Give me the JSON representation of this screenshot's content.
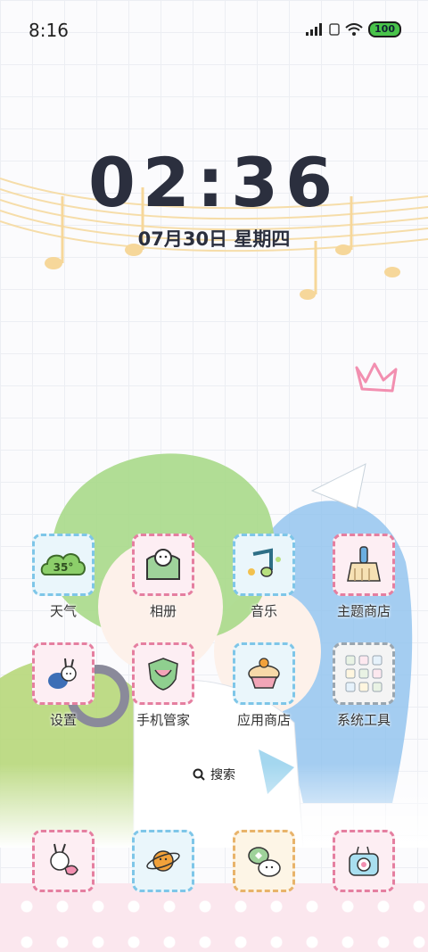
{
  "status": {
    "time": "8:16",
    "battery": "100"
  },
  "clock": {
    "time": "02:36",
    "date": "07月30日 星期四"
  },
  "apps": [
    {
      "id": "weather",
      "label": "天气",
      "glyph": "35°",
      "icon": "weather-icon",
      "color": "#7ec6e8"
    },
    {
      "id": "gallery",
      "label": "相册",
      "icon": "gallery-icon",
      "color": "#e57fa0"
    },
    {
      "id": "music",
      "label": "音乐",
      "icon": "music-icon",
      "color": "#7ec6e8"
    },
    {
      "id": "theme-store",
      "label": "主题商店",
      "icon": "brush-icon",
      "color": "#e57fa0"
    },
    {
      "id": "settings",
      "label": "设置",
      "icon": "bunny-icon",
      "color": "#e57fa0"
    },
    {
      "id": "phone-manager",
      "label": "手机管家",
      "icon": "shield-icon",
      "color": "#e57fa0"
    },
    {
      "id": "app-store",
      "label": "应用商店",
      "icon": "cupcake-icon",
      "color": "#7ec6e8"
    },
    {
      "id": "system-tools",
      "label": "系统工具",
      "icon": "folder-icon",
      "color": "#9aa6b0"
    }
  ],
  "search": {
    "label": "搜索"
  },
  "dock": [
    {
      "id": "phone",
      "icon": "bunny-phone-icon",
      "color": "#e57fa0"
    },
    {
      "id": "browser",
      "icon": "planet-icon",
      "color": "#7ec6e8"
    },
    {
      "id": "messages",
      "icon": "chat-icon",
      "color": "#e8b36a"
    },
    {
      "id": "camera",
      "icon": "camera-icon",
      "color": "#e57fa0"
    }
  ]
}
